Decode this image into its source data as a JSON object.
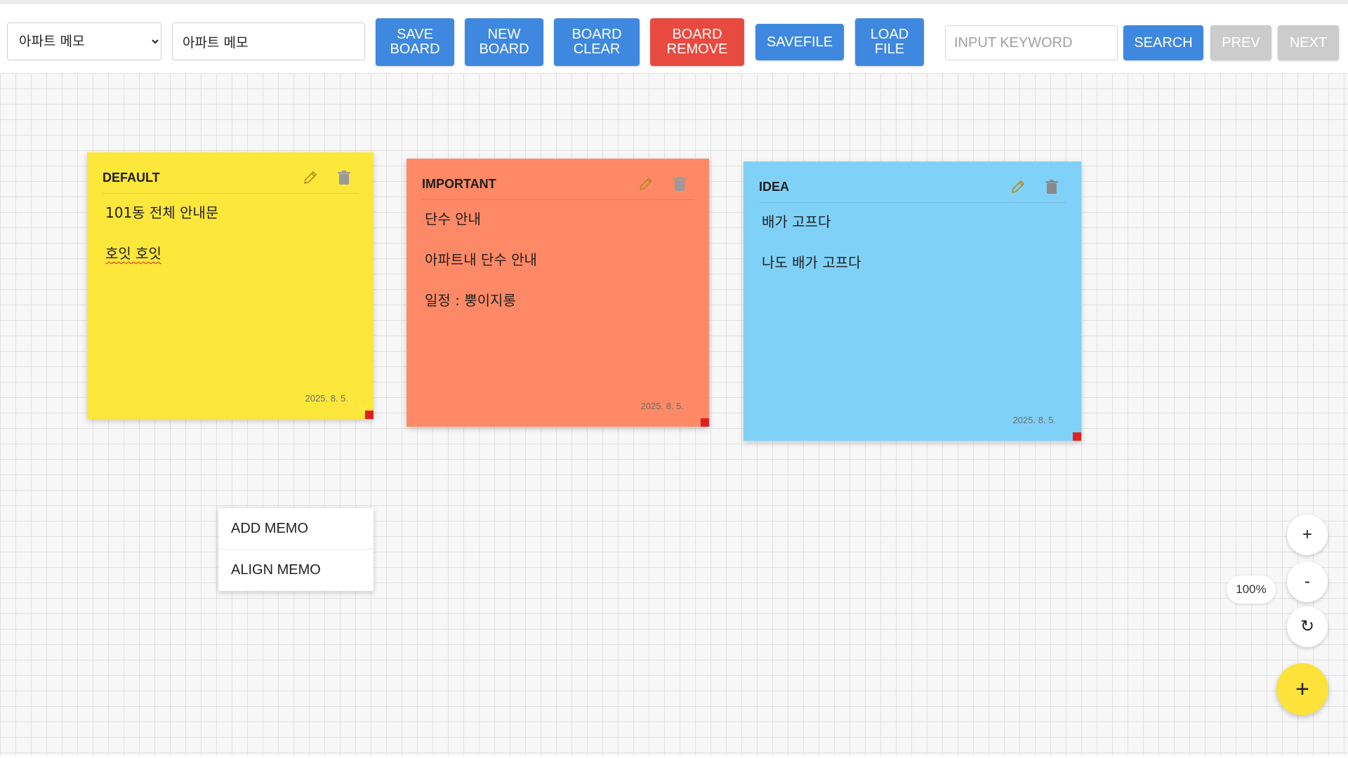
{
  "toolbar": {
    "board_select_value": "아파트 메모",
    "board_name_value": "아파트 메모",
    "save_board": "SAVE\nBOARD",
    "new_board": "NEW\nBOARD",
    "board_clear": "BOARD\nCLEAR",
    "board_remove": "BOARD\nREMOVE",
    "savefile": "SAVEFILE",
    "load_file": "LOAD\nFILE",
    "search_placeholder": "INPUT KEYWORD",
    "search": "SEARCH",
    "prev": "PREV",
    "next": "NEXT"
  },
  "colors": {
    "default_memo": "#fde73a",
    "important_memo": "#fe8966",
    "idea_memo": "#80d1f8",
    "primary_button": "#3f88e0",
    "danger_button": "#e84a3f",
    "disabled_button": "#cccccc"
  },
  "memos": [
    {
      "title": "DEFAULT",
      "lines": [
        "101동 전체 안내문",
        "호잇 호잇"
      ],
      "date": "2025. 8. 5."
    },
    {
      "title": "IMPORTANT",
      "lines": [
        "단수 안내",
        "아파트내 단수 안내",
        "일정 : 뿡이지롱"
      ],
      "date": "2025. 8. 5."
    },
    {
      "title": "IDEA",
      "lines": [
        "배가 고프다",
        "나도 배가 고프다"
      ],
      "date": "2025. 8. 5."
    }
  ],
  "context_menu": {
    "add_memo": "ADD MEMO",
    "align_memo": "ALIGN MEMO"
  },
  "zoom": {
    "zoom_in": "+",
    "zoom_out": "-",
    "level": "100%",
    "reset": "↻",
    "add": "+"
  },
  "icons": [
    "pencil-icon",
    "trash-icon",
    "rotate-icon",
    "plus-icon",
    "chevron-down-icon"
  ]
}
